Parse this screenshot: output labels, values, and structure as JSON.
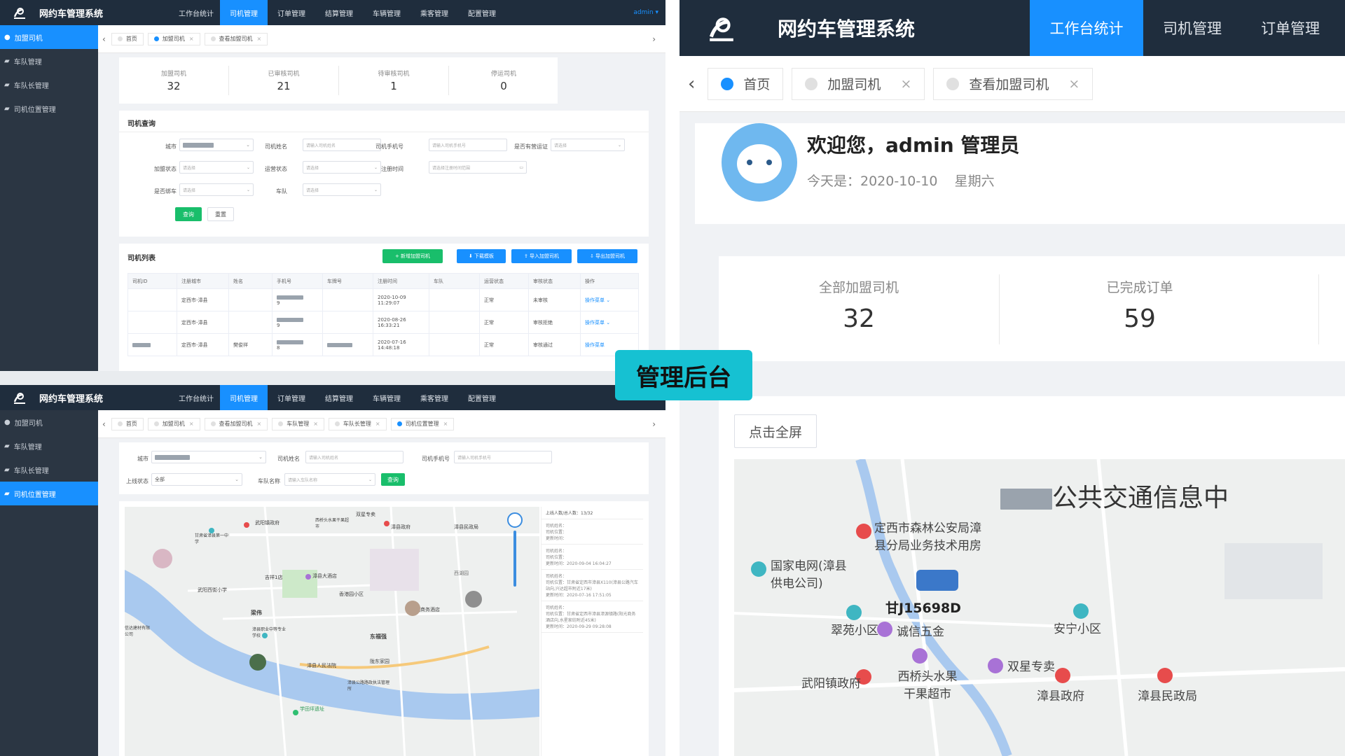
{
  "app": {
    "title": "网约车管理系统"
  },
  "nav": {
    "top_small": [
      "工作台统计",
      "司机管理",
      "订单管理",
      "结算管理",
      "车辆管理",
      "乘客管理",
      "配置管理"
    ],
    "top_large": [
      "工作台统计",
      "司机管理",
      "订单管理"
    ],
    "admin_label": "admin"
  },
  "sidebar": {
    "items": [
      "加盟司机",
      "车队管理",
      "车队长管理",
      "司机位置管理"
    ]
  },
  "win1": {
    "tabs": [
      "首页",
      "加盟司机",
      "查看加盟司机"
    ],
    "stats": [
      {
        "label": "加盟司机",
        "value": "32"
      },
      {
        "label": "已审核司机",
        "value": "21"
      },
      {
        "label": "待审核司机",
        "value": "1"
      },
      {
        "label": "停运司机",
        "value": "0"
      }
    ],
    "query_title": "司机查询",
    "fields": {
      "city": "城市",
      "driver_name": "司机姓名",
      "driver_name_ph": "请输入司机姓名",
      "driver_phone": "司机手机号",
      "driver_phone_ph": "请输入司机手机号",
      "has_license": "是否有营运证",
      "select_ph": "请选择",
      "join_status": "加盟状态",
      "op_status": "运营状态",
      "reg_time": "注册时间",
      "reg_time_ph": "请选择注册时间范围",
      "bound": "是否绑车",
      "fleet": "车队"
    },
    "search_btn": "查询",
    "reset_btn": "重置",
    "list_title": "司机列表",
    "actions": [
      "+ 新增加盟司机",
      "下载模板",
      "导入加盟司机",
      "导出加盟司机"
    ],
    "columns": [
      "司机ID",
      "注册城市",
      "姓名",
      "手机号",
      "车牌号",
      "注册时间",
      "车队",
      "运营状态",
      "审核状态",
      "操作"
    ],
    "rows": [
      {
        "city": "定西市-漳县",
        "name": "",
        "phone_tail": "9",
        "reg_date": "2020-10-09",
        "reg_time": "11:29:07",
        "status": "正常",
        "audit": "未审核",
        "op": "操作菜单"
      },
      {
        "city": "定西市-漳县",
        "name": "",
        "phone_tail": "9",
        "reg_date": "2020-08-26",
        "reg_time": "16:33:21",
        "status": "正常",
        "audit": "审核拒绝",
        "op": "操作菜单"
      },
      {
        "city": "定西市-漳县",
        "name": "樊俊祥",
        "phone_tail": "8",
        "reg_date": "2020-07-16",
        "reg_time": "14:48:18",
        "status": "正常",
        "audit": "审核通过",
        "op": "操作菜单"
      }
    ]
  },
  "win2": {
    "tabs": [
      "首页",
      "加盟司机",
      "查看加盟司机",
      "车队管理",
      "车队长管理",
      "司机位置管理"
    ],
    "fields": {
      "city": "城市",
      "driver_name": "司机姓名",
      "driver_name_ph": "请输入司机姓名",
      "driver_phone": "司机手机号",
      "driver_phone_ph": "请输入司机手机号",
      "online": "上线状态",
      "online_val": "全部",
      "fleet_name": "车队名称",
      "fleet_name_ph": "请输入车队名称"
    },
    "search_btn": "查询",
    "map_pois": [
      "双星专卖",
      "西桥头水果干果超市",
      "武阳镇政府",
      "漳县政府",
      "漳县民政局",
      "甘肃省漳县第一中学",
      "吉祥1店",
      "漳县大酒店",
      "武阳西街小学",
      "香港园小区",
      "梁伟",
      "漳县职业中等专业学校",
      "阳光商务酒店",
      "东福强",
      "漳县人民法院",
      "陇东家园",
      "漳县公路路政执法管理所",
      "学田坪遗址",
      "信达建材有限公司",
      "西湖园"
    ],
    "info_header": "上线人数/总人数：13/32",
    "info_blocks": [
      {
        "name": "司机姓名：",
        "pos": "司机位置：",
        "time": "更新时间："
      },
      {
        "name": "司机姓名：",
        "pos": "司机位置：",
        "time": "更新时间：2020-09-04 16:04:27"
      },
      {
        "name": "司机姓名：",
        "pos": "司机位置：甘肃省定西市漳县X110(漳县公路汽车站向,兴达超市附近17米)",
        "time": "更新时间：2020-07-16 17:51:05"
      },
      {
        "name": "司机姓名：",
        "pos": "司机位置：甘肃省定西市漳县漳源镇路(阳光商务酒店向,水星家纺附近45米)",
        "time": "更新时间：2020-09-29 09:28:08"
      }
    ]
  },
  "win3": {
    "tabs": [
      "首页",
      "加盟司机",
      "查看加盟司机"
    ],
    "welcome": "欢迎您，admin 管理员",
    "today": "今天是：2020-10-10",
    "weekday": "星期六",
    "stats": [
      {
        "label": "全部加盟司机",
        "value": "32"
      },
      {
        "label": "已完成订单",
        "value": "59"
      }
    ],
    "fullscreen_btn": "点击全屏",
    "map_title": "公共交通信息中",
    "map_pois": [
      {
        "name": "定西市森林公安局漳县分局业务技术用房"
      },
      {
        "name": "国家电网(漳县供电公司)"
      },
      {
        "name": "甘J15698D"
      },
      {
        "name": "翠苑小区"
      },
      {
        "name": "诚信五金"
      },
      {
        "name": "安宁小区"
      },
      {
        "name": "西桥头水果干果超市"
      },
      {
        "name": "双星专卖"
      },
      {
        "name": "武阳镇政府"
      },
      {
        "name": "漳县政府"
      },
      {
        "name": "漳县民政局"
      }
    ]
  },
  "badge": "管理后台",
  "colors": {
    "nav_bg": "#1f2d3d",
    "accent": "#1890ff",
    "sidebar_bg": "#2b3643",
    "badge": "#16c1d2",
    "success": "#19be6b"
  }
}
